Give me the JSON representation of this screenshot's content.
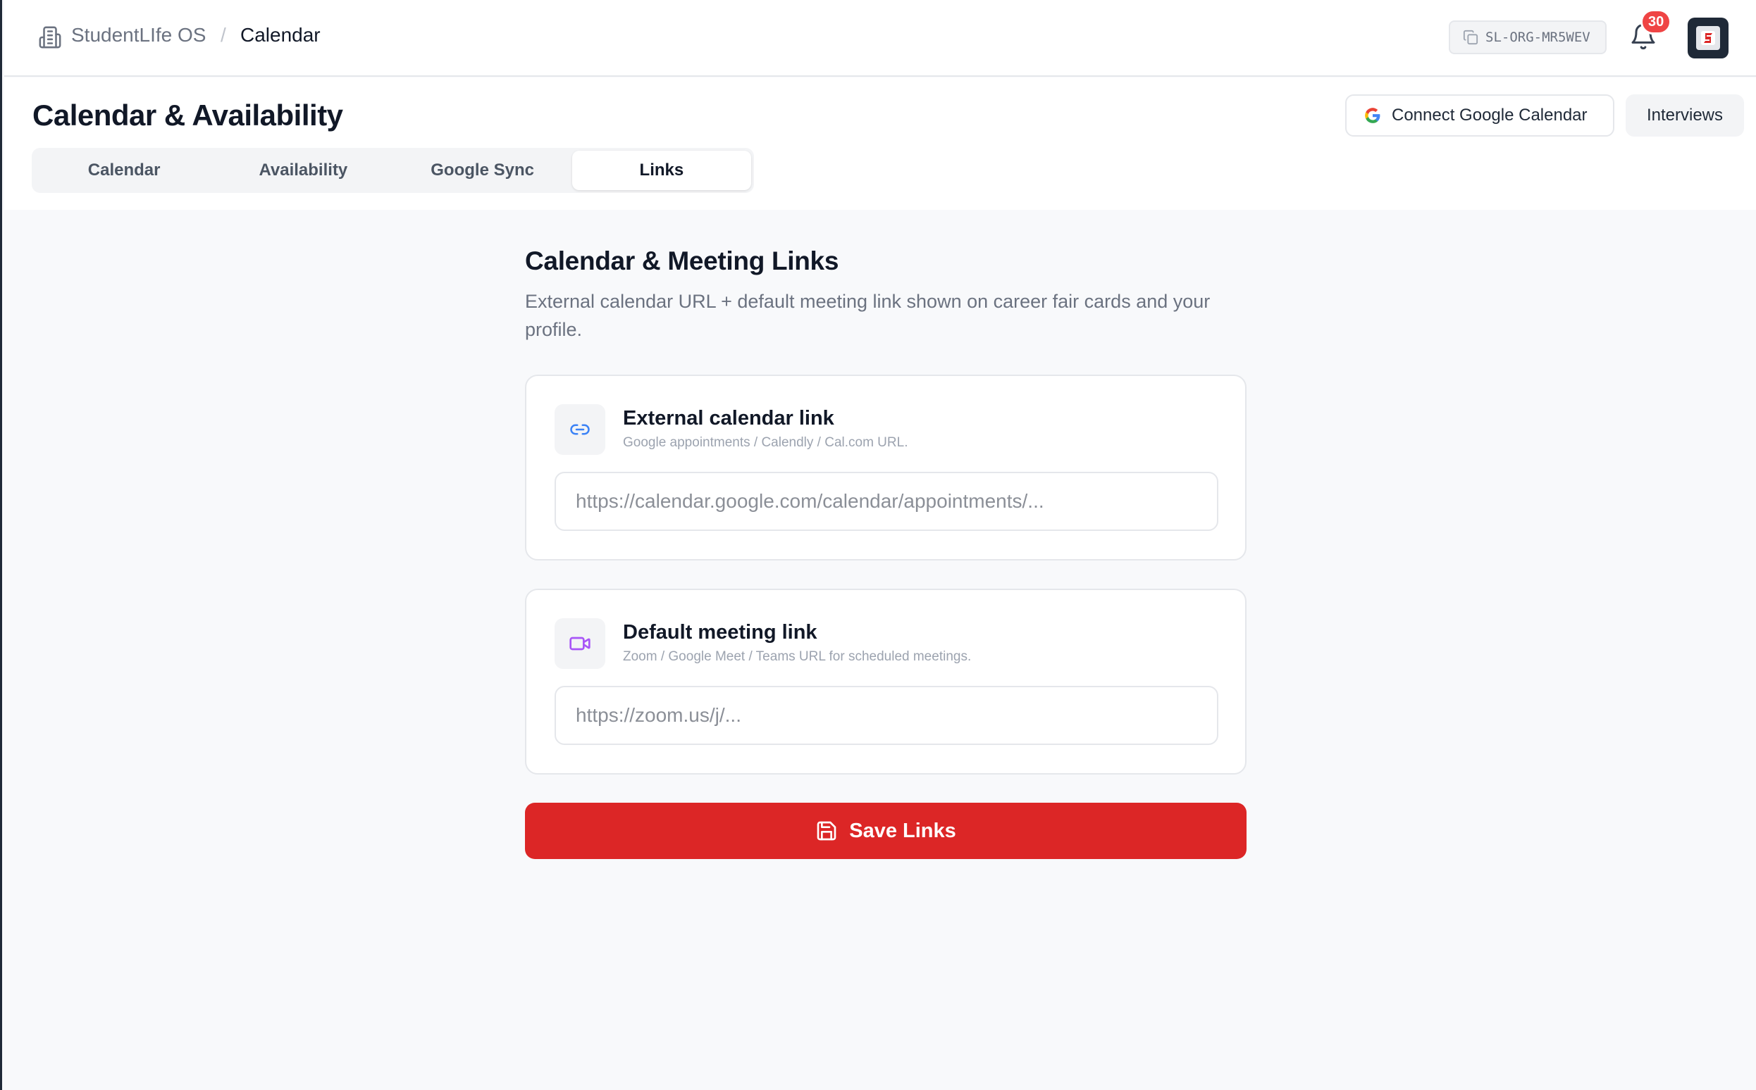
{
  "breadcrumb": {
    "root": "StudentLIfe OS",
    "separator": "/",
    "current": "Calendar"
  },
  "topbar": {
    "org_code": "SL-ORG-MR5WEV",
    "notifications_count": "30",
    "icons": [
      "building-icon",
      "copy-icon",
      "bell-icon",
      "avatar"
    ]
  },
  "page": {
    "title": "Calendar & Availability",
    "connect_google_label": "Connect Google Calendar",
    "interviews_label": "Interviews"
  },
  "tabs": [
    {
      "label": "Calendar",
      "active": false
    },
    {
      "label": "Availability",
      "active": false
    },
    {
      "label": "Google Sync",
      "active": false
    },
    {
      "label": "Links",
      "active": true
    }
  ],
  "section": {
    "title": "Calendar & Meeting Links",
    "description": "External calendar URL + default meeting link shown on career fair cards and your profile."
  },
  "cards": [
    {
      "title": "External calendar link",
      "subtitle": "Google appointments / Calendly / Cal.com URL.",
      "placeholder": "https://calendar.google.com/calendar/appointments/...",
      "value": "",
      "icon": "link-icon"
    },
    {
      "title": "Default meeting link",
      "subtitle": "Zoom / Google Meet / Teams URL for scheduled meetings.",
      "placeholder": "https://zoom.us/j/...",
      "value": "",
      "icon": "video-icon"
    }
  ],
  "save_button": {
    "label": "Save Links"
  },
  "colors": {
    "accent": "#dc2626",
    "badge": "#ef4444",
    "link_icon": "#3b82f6",
    "video_icon": "#a855f7",
    "text_primary": "#111827",
    "text_muted": "#6b7280"
  }
}
